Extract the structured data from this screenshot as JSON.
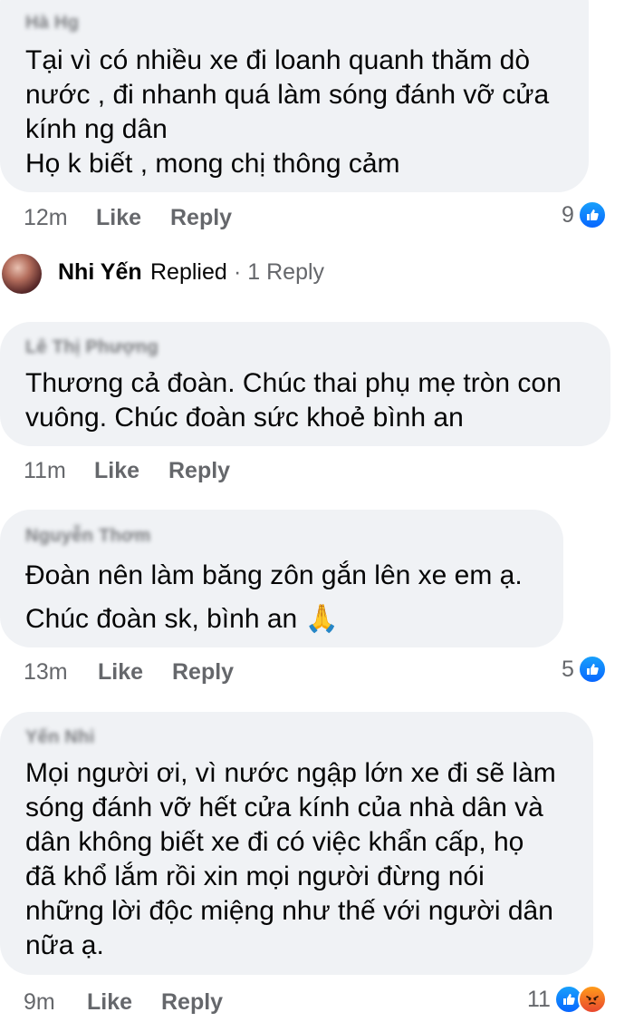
{
  "comments": [
    {
      "author": "Hà Hg",
      "lines": [
        "Tại vì có nhiều xe đi loanh quanh thăm dò",
        "nước , đi nhanh quá làm sóng đánh vỡ cửa",
        "kính ng dân",
        "Họ k biết , mong chị thông cảm"
      ],
      "time": "12m",
      "like": "Like",
      "reply": "Reply",
      "reaction_count": "9"
    },
    {
      "author": "Lê Thị Phượng",
      "lines": [
        "Thương cả đoàn. Chúc thai phụ mẹ tròn con",
        "vuông. Chúc đoàn sức khoẻ bình an"
      ],
      "time": "11m",
      "like": "Like",
      "reply": "Reply"
    },
    {
      "author": "Nguyễn Thơm",
      "lines": [
        "Đoàn nên làm băng zôn gắn lên xe em ạ.",
        "Chúc đoàn sk, bình an 🙏"
      ],
      "time": "13m",
      "like": "Like",
      "reply": "Reply",
      "reaction_count": "5"
    },
    {
      "author": "Yến Nhi",
      "lines": [
        "Mọi người ơi, vì nước ngập lớn xe đi sẽ làm",
        "sóng đánh vỡ hết cửa kính của nhà dân và",
        "dân không biết xe đi có việc khẩn cấp, họ",
        "đã khổ lắm rồi xin mọi người đừng nói",
        "những lời độc miệng như thế với người dân",
        "nữa ạ."
      ],
      "time": "9m",
      "like": "Like",
      "reply": "Reply",
      "reaction_count": "11"
    }
  ],
  "replied": {
    "name": "Nhi Yến",
    "label": "Replied",
    "count": "· 1 Reply"
  },
  "icons": {
    "like": "like-reaction-icon",
    "angry": "angry-reaction-icon",
    "pray": "folded-hands-emoji"
  },
  "colors": {
    "bubble": "#f0f2f5",
    "meta": "#65676b",
    "like_blue": "#0866ff"
  }
}
